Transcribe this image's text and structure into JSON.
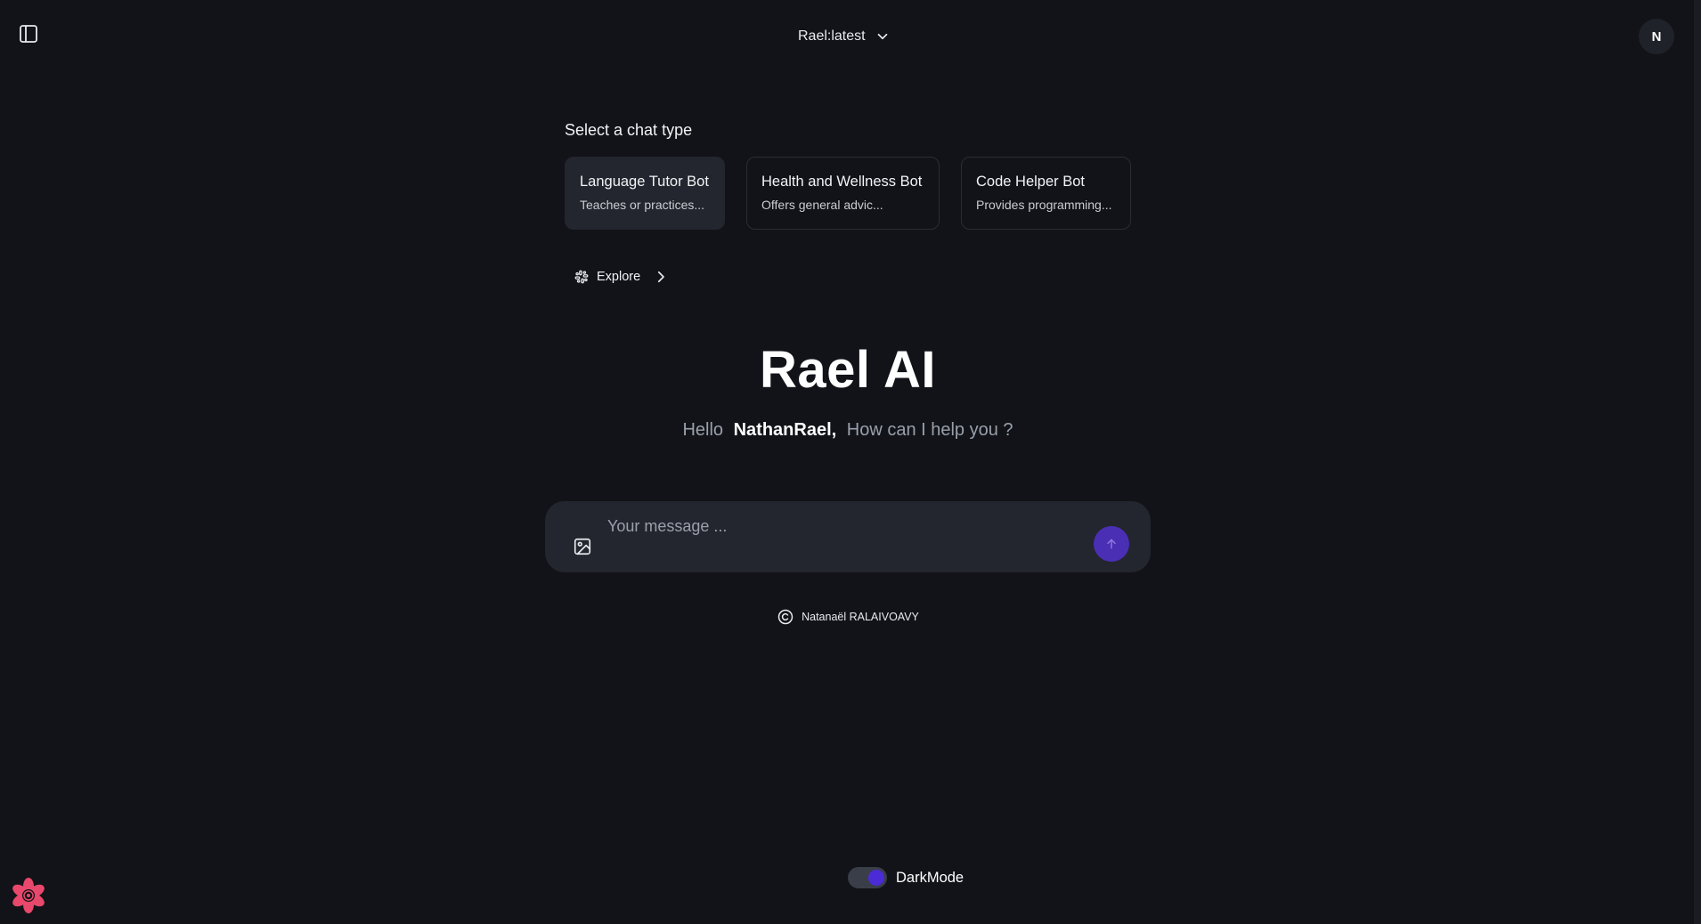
{
  "header": {
    "model_name": "Rael:latest",
    "avatar_initial": "N"
  },
  "chat_types": {
    "heading": "Select a chat type",
    "cards": [
      {
        "title": "Language Tutor Bot",
        "description": "Teaches or practices...",
        "selected": true
      },
      {
        "title": "Health and Wellness Bot",
        "description": "Offers general advic...",
        "selected": false
      },
      {
        "title": "Code Helper Bot",
        "description": "Provides programming...",
        "selected": false
      }
    ],
    "explore_label": "Explore"
  },
  "hero": {
    "title": "Rael AI",
    "greeting_prefix": "Hello",
    "user_name": "NathanRael,",
    "greeting_suffix": "How can I help you ?"
  },
  "composer": {
    "placeholder": "Your message ...",
    "value": ""
  },
  "footer": {
    "copyright_name": "Natanaël RALAIVOAVY",
    "darkmode_label": "DarkMode",
    "darkmode_on": true
  },
  "colors": {
    "background": "#111318",
    "surface": "#23262e",
    "accent": "#4b2bd6",
    "send_button": "#4a2fb5",
    "muted_text": "#9aa0ab"
  },
  "icons": {
    "sidebar_toggle": "sidebar-toggle-icon",
    "model_dropdown": "chevron-down-icon",
    "explore": "grid-icon",
    "explore_arrow": "chevron-right-icon",
    "image_upload": "image-icon",
    "send": "arrow-up-icon",
    "copyright": "copyright-icon",
    "logo": "flower-logo-icon"
  }
}
